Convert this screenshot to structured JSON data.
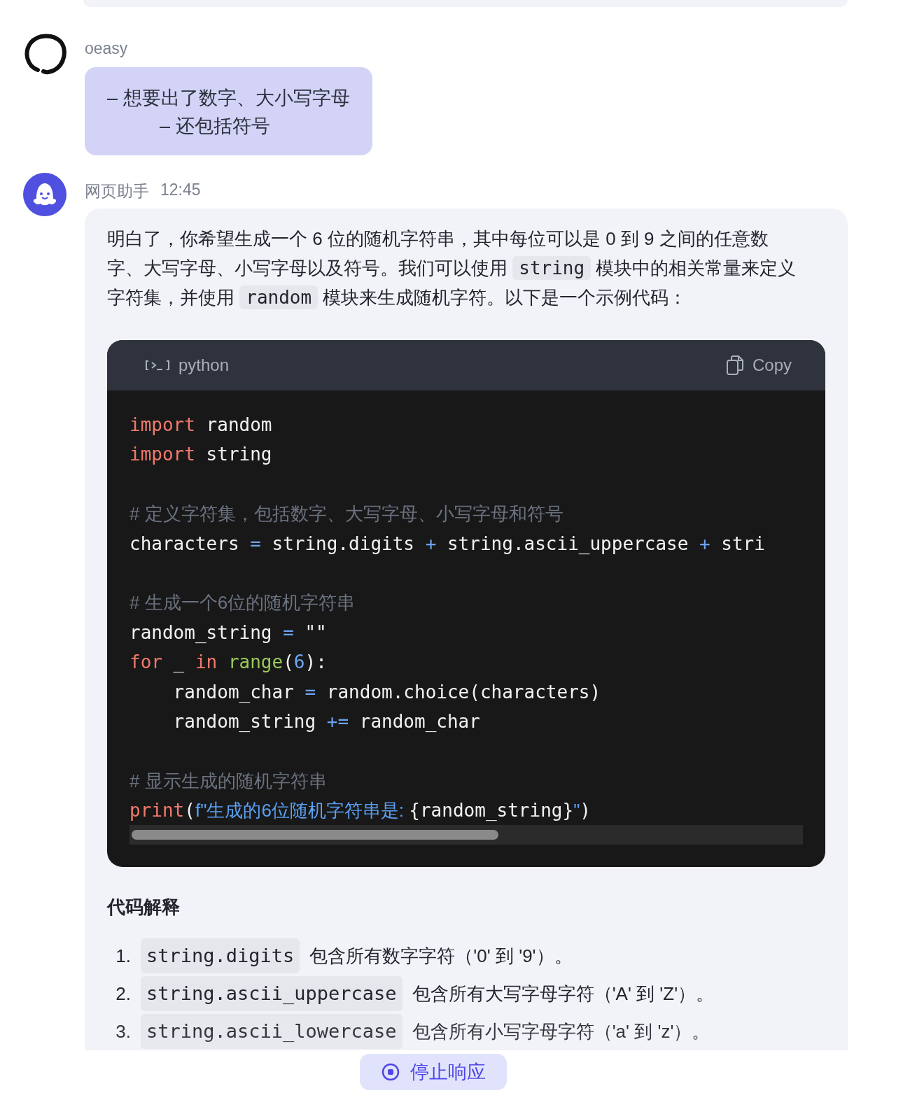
{
  "messages": [
    {
      "kind": "user",
      "author": "oeasy",
      "lines": [
        "– 想要出了数字、大小写字母",
        "– 还包括符号"
      ]
    },
    {
      "kind": "assistant",
      "author": "网页助手",
      "time": "12:45",
      "intro": [
        {
          "text": "明白了，你希望生成一个 6 位的随机字符串，其中每位可以是 0 到 9 之间的任意数字、大写字母、小写字母以及符号。我们可以使用 ",
          "code": false
        },
        {
          "text": "string",
          "code": true
        },
        {
          "text": " 模块中的相关常量来定义字符集，并使用 ",
          "code": false
        },
        {
          "text": "random",
          "code": true
        },
        {
          "text": " 模块来生成随机字符。以下是一个示例代码：",
          "code": false
        }
      ],
      "code_block": {
        "language": "python",
        "copy_label": "Copy",
        "lines": [
          {
            "kind": "code",
            "tokens": [
              {
                "t": "import",
                "kind": "keyword"
              },
              {
                "t": " random",
                "kind": "name"
              }
            ]
          },
          {
            "kind": "code",
            "tokens": [
              {
                "t": "import",
                "kind": "keyword"
              },
              {
                "t": " string",
                "kind": "name"
              }
            ]
          },
          {
            "kind": "blank"
          },
          {
            "kind": "code",
            "tokens": [
              {
                "t": "# 定义字符集，包括数字、大写字母、小写字母和符号",
                "kind": "comment"
              }
            ]
          },
          {
            "kind": "code",
            "tokens": [
              {
                "t": "characters ",
                "kind": "name"
              },
              {
                "t": "=",
                "kind": "operator"
              },
              {
                "t": " string.digits ",
                "kind": "name"
              },
              {
                "t": "+",
                "kind": "operator"
              },
              {
                "t": " string.ascii_uppercase ",
                "kind": "name"
              },
              {
                "t": "+",
                "kind": "operator"
              },
              {
                "t": " stri",
                "kind": "name"
              }
            ]
          },
          {
            "kind": "blank"
          },
          {
            "kind": "code",
            "tokens": [
              {
                "t": "# 生成一个6位的随机字符串",
                "kind": "comment"
              }
            ]
          },
          {
            "kind": "code",
            "tokens": [
              {
                "t": "random_string ",
                "kind": "name"
              },
              {
                "t": "=",
                "kind": "operator"
              },
              {
                "t": " \"\"",
                "kind": "name"
              }
            ]
          },
          {
            "kind": "code",
            "tokens": [
              {
                "t": "for",
                "kind": "keyword"
              },
              {
                "t": " _ ",
                "kind": "name"
              },
              {
                "t": "in",
                "kind": "keyword"
              },
              {
                "t": " range",
                "kind": "builtin"
              },
              {
                "t": "(",
                "kind": "name"
              },
              {
                "t": "6",
                "kind": "number"
              },
              {
                "t": "):",
                "kind": "name"
              }
            ]
          },
          {
            "kind": "code",
            "tokens": [
              {
                "t": "    random_char ",
                "kind": "name"
              },
              {
                "t": "=",
                "kind": "operator"
              },
              {
                "t": " random.choice(characters)",
                "kind": "name"
              }
            ]
          },
          {
            "kind": "code",
            "tokens": [
              {
                "t": "    random_string ",
                "kind": "name"
              },
              {
                "t": "+=",
                "kind": "operator"
              },
              {
                "t": " random_char",
                "kind": "name"
              }
            ]
          },
          {
            "kind": "blank"
          },
          {
            "kind": "code",
            "tokens": [
              {
                "t": "# 显示生成的随机字符串",
                "kind": "comment"
              }
            ]
          },
          {
            "kind": "code",
            "tokens": [
              {
                "t": "print",
                "kind": "keyword"
              },
              {
                "t": "(",
                "kind": "name"
              },
              {
                "t": "f\"生成的6位随机字符串是: ",
                "kind": "string"
              },
              {
                "t": "{random_string}",
                "kind": "name"
              },
              {
                "t": "\"",
                "kind": "string"
              },
              {
                "t": ")",
                "kind": "name"
              }
            ]
          }
        ]
      },
      "section_title": "代码解释",
      "explanations": [
        {
          "number": "1.",
          "code": "string.digits",
          "text": "包含所有数字字符（'0' 到 '9'）。"
        },
        {
          "number": "2.",
          "code": "string.ascii_uppercase",
          "text": "包含所有大写字母字符（'A' 到 'Z'）。"
        },
        {
          "number": "3.",
          "code": "string.ascii_lowercase",
          "text": "包含所有小写字母字符（'a' 到 'z'）。"
        }
      ]
    }
  ],
  "stop_button": {
    "label": "停止响应"
  }
}
